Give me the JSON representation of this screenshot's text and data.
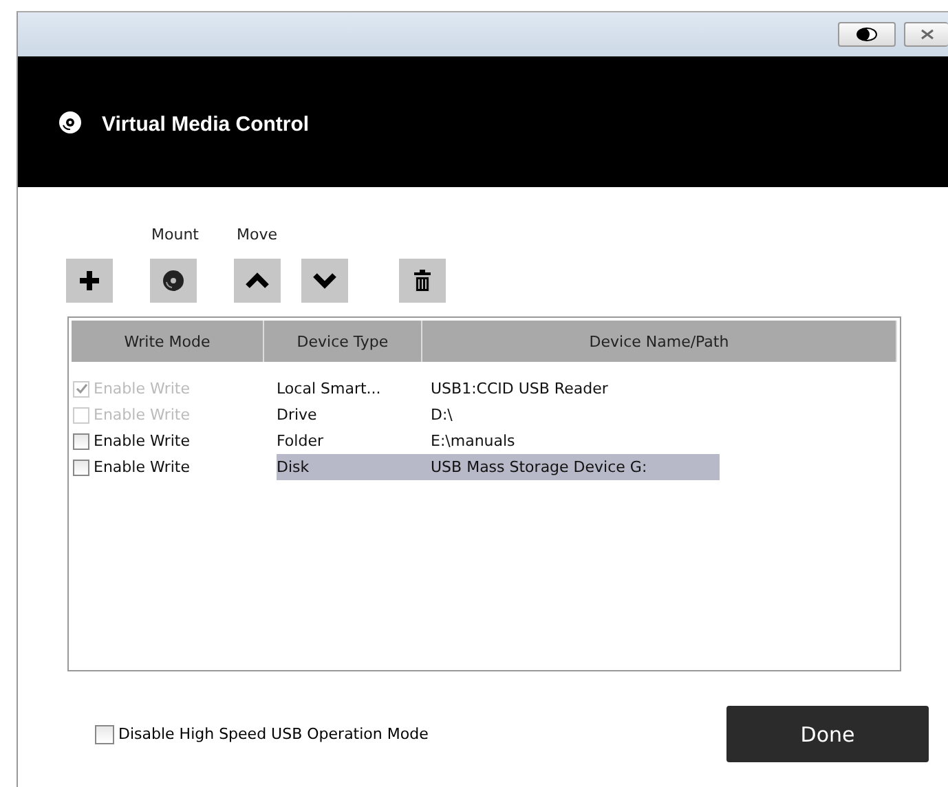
{
  "header": {
    "title": "Virtual Media Control"
  },
  "toolbar": {
    "labels": [
      {
        "kind": "mount",
        "text": "Mount"
      },
      {
        "kind": "move",
        "text": "Move"
      }
    ],
    "buttons": [
      {
        "kind": "add"
      },
      {
        "kind": "mount"
      },
      {
        "kind": "up"
      },
      {
        "kind": "down"
      },
      {
        "kind": "delete"
      }
    ]
  },
  "table": {
    "columns": [
      "Write Mode",
      "Device Type",
      "Device Name/Path"
    ],
    "rows": [
      {
        "write_mode": "Enable Write",
        "checked": true,
        "disabled": true,
        "selected": false,
        "device_type": "Local Smart...",
        "device_path": "USB1:CCID USB Reader"
      },
      {
        "write_mode": "Enable Write",
        "checked": false,
        "disabled": true,
        "selected": false,
        "device_type": "Drive",
        "device_path": "D:\\"
      },
      {
        "write_mode": "Enable Write",
        "checked": false,
        "disabled": false,
        "selected": false,
        "device_type": "Folder",
        "device_path": "E:\\manuals"
      },
      {
        "write_mode": "Enable Write",
        "checked": false,
        "disabled": false,
        "selected": true,
        "device_type": "Disk",
        "device_path": "USB Mass Storage Device G:"
      }
    ]
  },
  "options": {
    "label": "Disable High Speed USB Operation Mode",
    "checked": false
  },
  "done_button": "Done"
}
